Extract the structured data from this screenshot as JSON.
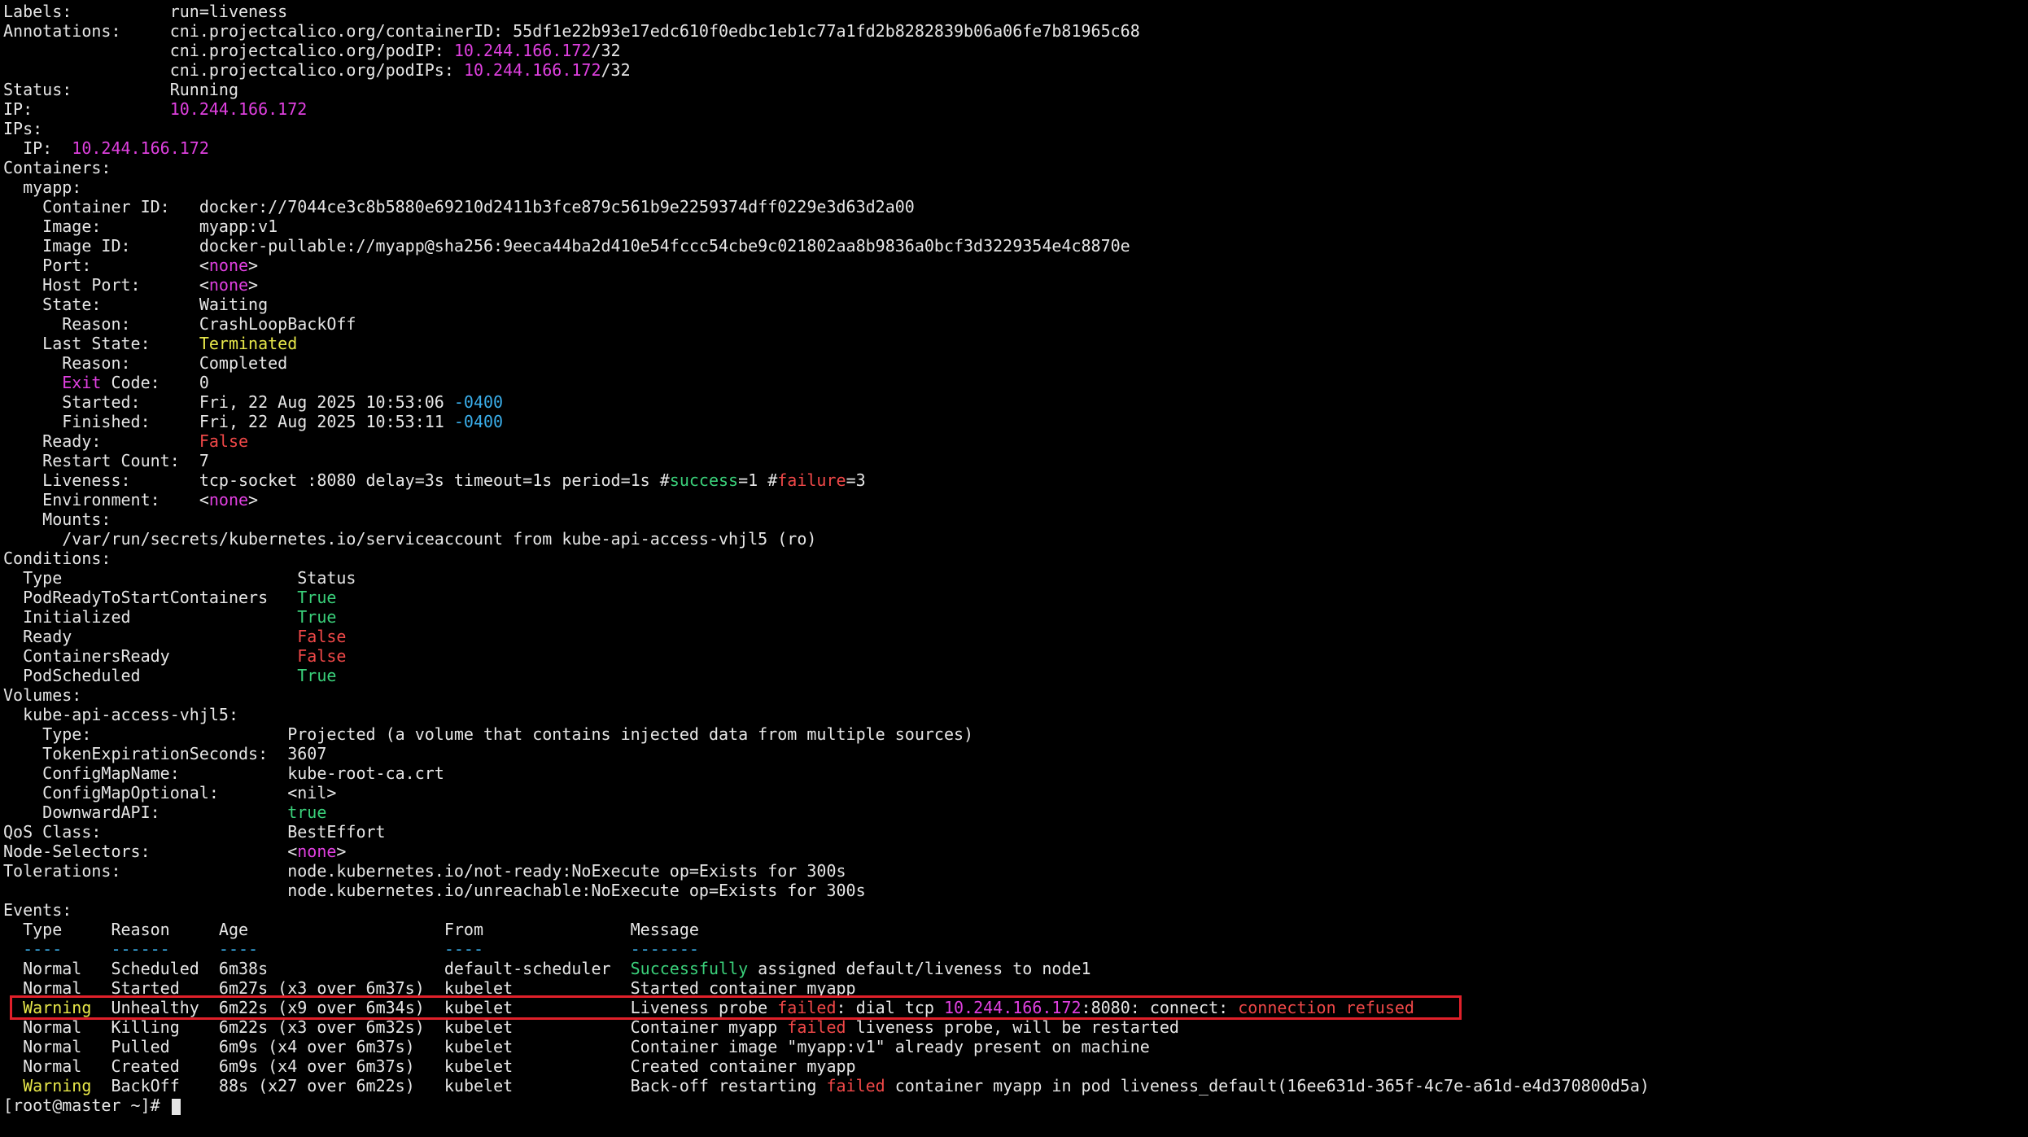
{
  "colors": {
    "default": "#e6e6e6",
    "magenta": "#e040e0",
    "cyan": "#3aaeea",
    "yellow": "#e8e84a",
    "red": "#f04848",
    "green": "#3ad07a",
    "highlight_border": "#e0202a",
    "background": "#000000"
  },
  "terminal": {
    "lines": [
      [
        [
          "Labels:          run=liveness",
          "default"
        ]
      ],
      [
        [
          "Annotations:     cni.projectcalico.org/containerID: 55df1e22b93e17edc610f0edbc1eb1c77a1fd2b8282839b06a06fe7b81965c68",
          "default"
        ]
      ],
      [
        [
          "                 cni.projectcalico.org/podIP: ",
          "default"
        ],
        [
          "10.244.166.172",
          "magenta"
        ],
        [
          "/32",
          "default"
        ]
      ],
      [
        [
          "                 cni.projectcalico.org/podIPs: ",
          "default"
        ],
        [
          "10.244.166.172",
          "magenta"
        ],
        [
          "/32",
          "default"
        ]
      ],
      [
        [
          "Status:          Running",
          "default"
        ]
      ],
      [
        [
          "IP:              ",
          "default"
        ],
        [
          "10.244.166.172",
          "magenta"
        ]
      ],
      [
        [
          "IPs:",
          "default"
        ]
      ],
      [
        [
          "  IP:  ",
          "default"
        ],
        [
          "10.244.166.172",
          "magenta"
        ]
      ],
      [
        [
          "Containers:",
          "default"
        ]
      ],
      [
        [
          "  myapp:",
          "default"
        ]
      ],
      [
        [
          "    Container ID:   docker://7044ce3c8b5880e69210d2411b3fce879c561b9e2259374dff0229e3d63d2a00",
          "default"
        ]
      ],
      [
        [
          "    Image:          myapp:v1",
          "default"
        ]
      ],
      [
        [
          "    Image ID:       docker-pullable://myapp@sha256:9eeca44ba2d410e54fccc54cbe9c021802aa8b9836a0bcf3d3229354e4c8870e",
          "default"
        ]
      ],
      [
        [
          "    Port:           ",
          "default"
        ],
        [
          "<",
          "default"
        ],
        [
          "none",
          "magenta"
        ],
        [
          ">",
          "default"
        ]
      ],
      [
        [
          "    Host Port:      ",
          "default"
        ],
        [
          "<",
          "default"
        ],
        [
          "none",
          "magenta"
        ],
        [
          ">",
          "default"
        ]
      ],
      [
        [
          "    State:          Waiting",
          "default"
        ]
      ],
      [
        [
          "      Reason:       CrashLoopBackOff",
          "default"
        ]
      ],
      [
        [
          "    Last State:     ",
          "default"
        ],
        [
          "Terminated",
          "yellow"
        ]
      ],
      [
        [
          "      Reason:       Completed",
          "default"
        ]
      ],
      [
        [
          "      ",
          "default"
        ],
        [
          "Exit",
          "magenta"
        ],
        [
          " Code:    0",
          "default"
        ]
      ],
      [
        [
          "      Started:      Fri, 22 Aug 2025 10:53:06 ",
          "default"
        ],
        [
          "-0400",
          "cyan"
        ]
      ],
      [
        [
          "      Finished:     Fri, 22 Aug 2025 10:53:11 ",
          "default"
        ],
        [
          "-0400",
          "cyan"
        ]
      ],
      [
        [
          "    Ready:          ",
          "default"
        ],
        [
          "False",
          "red"
        ]
      ],
      [
        [
          "    Restart Count:  7",
          "default"
        ]
      ],
      [
        [
          "    Liveness:       tcp-socket :8080 delay=3s timeout=1s period=1s #",
          "default"
        ],
        [
          "success",
          "green"
        ],
        [
          "=1 #",
          "default"
        ],
        [
          "failure",
          "red"
        ],
        [
          "=3",
          "default"
        ]
      ],
      [
        [
          "    Environment:    ",
          "default"
        ],
        [
          "<",
          "default"
        ],
        [
          "none",
          "magenta"
        ],
        [
          ">",
          "default"
        ]
      ],
      [
        [
          "    Mounts:",
          "default"
        ]
      ],
      [
        [
          "      /var/run/secrets/kubernetes.io/serviceaccount from kube-api-access-vhjl5 (ro)",
          "default"
        ]
      ],
      [
        [
          "Conditions:",
          "default"
        ]
      ],
      [
        [
          "  Type                        Status",
          "default"
        ]
      ],
      [
        [
          "  PodReadyToStartContainers   ",
          "default"
        ],
        [
          "True",
          "green"
        ]
      ],
      [
        [
          "  Initialized                 ",
          "default"
        ],
        [
          "True",
          "green"
        ]
      ],
      [
        [
          "  Ready                       ",
          "default"
        ],
        [
          "False",
          "red"
        ]
      ],
      [
        [
          "  ContainersReady             ",
          "default"
        ],
        [
          "False",
          "red"
        ]
      ],
      [
        [
          "  PodScheduled                ",
          "default"
        ],
        [
          "True",
          "green"
        ]
      ],
      [
        [
          "Volumes:",
          "default"
        ]
      ],
      [
        [
          "  kube-api-access-vhjl5:",
          "default"
        ]
      ],
      [
        [
          "    Type:                    Projected (a volume that contains injected data from multiple sources)",
          "default"
        ]
      ],
      [
        [
          "    TokenExpirationSeconds:  3607",
          "default"
        ]
      ],
      [
        [
          "    ConfigMapName:           kube-root-ca.crt",
          "default"
        ]
      ],
      [
        [
          "    ConfigMapOptional:       <nil>",
          "default"
        ]
      ],
      [
        [
          "    DownwardAPI:             ",
          "default"
        ],
        [
          "true",
          "green"
        ]
      ],
      [
        [
          "QoS Class:                   BestEffort",
          "default"
        ]
      ],
      [
        [
          "Node-Selectors:              ",
          "default"
        ],
        [
          "<",
          "default"
        ],
        [
          "none",
          "magenta"
        ],
        [
          ">",
          "default"
        ]
      ],
      [
        [
          "Tolerations:                 node.kubernetes.io/not-ready:NoExecute op=Exists for 300s",
          "default"
        ]
      ],
      [
        [
          "                             node.kubernetes.io/unreachable:NoExecute op=Exists for 300s",
          "default"
        ]
      ],
      [
        [
          "Events:",
          "default"
        ]
      ],
      [
        [
          "  Type     Reason     Age                    From               Message",
          "default"
        ]
      ],
      [
        [
          "  ----     ------     ----                   ----               -------",
          "cyan"
        ]
      ],
      [
        [
          "  Normal   Scheduled  6m38s                  default-scheduler  ",
          "default"
        ],
        [
          "Successfully",
          "green"
        ],
        [
          " assigned default/liveness to node1",
          "default"
        ]
      ],
      [
        [
          "  Normal   Started    6m27s (x3 over 6m37s)  kubelet            Started container myapp",
          "default"
        ]
      ],
      [
        [
          "  ",
          "default"
        ],
        [
          "Warning",
          "yellow"
        ],
        [
          "  Unhealthy  6m22s (x9 over 6m34s)  kubelet            Liveness probe ",
          "default"
        ],
        [
          "failed",
          "red"
        ],
        [
          ": dial tcp ",
          "default"
        ],
        [
          "10.244.166.172",
          "magenta"
        ],
        [
          ":8080: connect: ",
          "default"
        ],
        [
          "connection refused",
          "red"
        ]
      ],
      [
        [
          "  Normal   Killing    6m22s (x3 over 6m32s)  kubelet            Container myapp ",
          "default"
        ],
        [
          "failed",
          "red"
        ],
        [
          " liveness probe, will be restarted",
          "default"
        ]
      ],
      [
        [
          "  Normal   Pulled     6m9s (x4 over 6m37s)   kubelet            Container image \"myapp:v1\" already present on machine",
          "default"
        ]
      ],
      [
        [
          "  Normal   Created    6m9s (x4 over 6m37s)   kubelet            Created container myapp",
          "default"
        ]
      ],
      [
        [
          "  ",
          "default"
        ],
        [
          "Warning",
          "yellow"
        ],
        [
          "  BackOff    88s (x27 over 6m22s)   kubelet            Back-off restarting ",
          "default"
        ],
        [
          "failed",
          "red"
        ],
        [
          " container myapp in pod liveness_default(16ee631d-365f-4c7e-a61d-e4d370800d5a)",
          "default"
        ]
      ],
      [
        [
          "[root@master ~]# ",
          "default"
        ]
      ]
    ],
    "prompt_line_index": 56,
    "highlighted_line_index": 51
  }
}
